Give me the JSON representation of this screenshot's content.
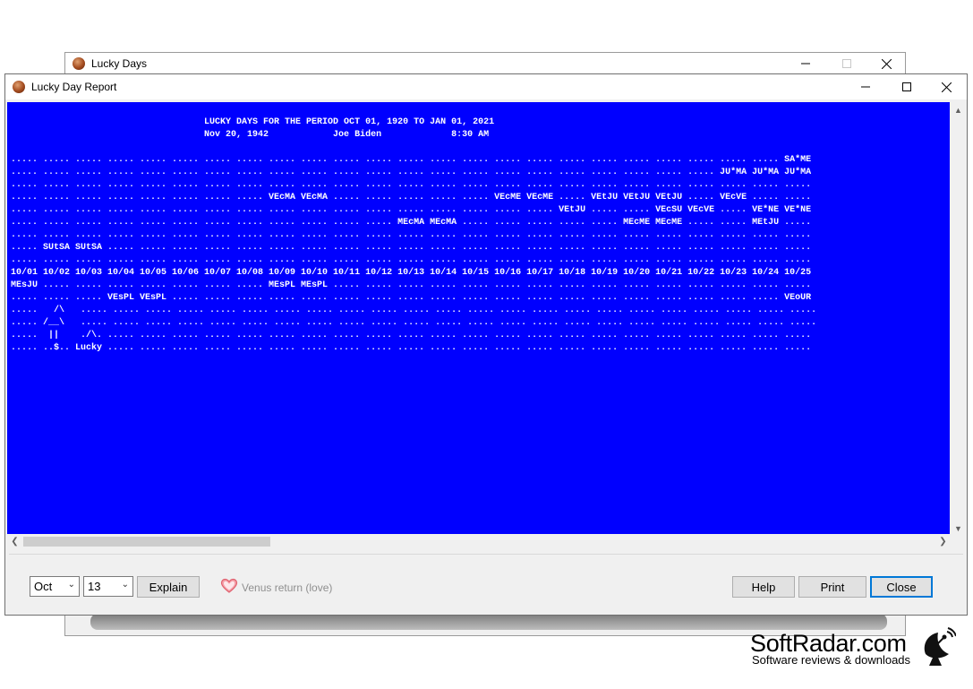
{
  "background_window": {
    "title": "Lucky Days",
    "icon": "lucky-days-app-icon",
    "controls": [
      "minimize",
      "maximize-disabled",
      "close"
    ]
  },
  "report_window": {
    "title": "Lucky Day Report",
    "icon": "lucky-days-app-icon",
    "controls": [
      "minimize",
      "maximize",
      "close"
    ],
    "background_color": "#0000ff",
    "text_color": "#ffffff",
    "report_lines": [
      "                                    LUCKY DAYS FOR THE PERIOD OCT 01, 1920 TO JAN 01, 2021",
      "                                    Nov 20, 1942            Joe Biden             8:30 AM",
      "",
      "..... ..... ..... ..... ..... ..... ..... ..... ..... ..... ..... ..... ..... ..... ..... ..... ..... ..... ..... ..... ..... ..... ..... ..... SA*ME",
      "..... ..... ..... ..... ..... ..... ..... ..... ..... ..... ..... ..... ..... ..... ..... ..... ..... ..... ..... ..... ..... ..... JU*MA JU*MA JU*MA",
      "..... ..... ..... ..... ..... ..... ..... ..... ..... ..... ..... ..... ..... ..... ..... ..... ..... ..... ..... ..... ..... ..... ..... ..... .....",
      "..... ..... ..... ..... ..... ..... ..... ..... VEcMA VEcMA ..... ..... ..... ..... ..... VEcME VEcME ..... VEtJU VEtJU VEtJU ..... VEcVE ..... .....",
      "..... ..... ..... ..... ..... ..... ..... ..... ..... ..... ..... ..... ..... ..... ..... ..... ..... VEtJU ..... ..... VEcSU VEcVE ..... VE*NE VE*NE",
      "..... ..... ..... ..... ..... ..... ..... ..... ..... ..... ..... ..... MEcMA MEcMA ..... ..... ..... ..... ..... MEcME MEcME ..... ..... MEtJU .....",
      "..... ..... ..... ..... ..... ..... ..... ..... ..... ..... ..... ..... ..... ..... ..... ..... ..... ..... ..... ..... ..... ..... ..... ..... .....",
      "..... SUtSA SUtSA ..... ..... ..... ..... ..... ..... ..... ..... ..... ..... ..... ..... ..... ..... ..... ..... ..... ..... ..... ..... ..... .....",
      "..... ..... ..... ..... ..... ..... ..... ..... ..... ..... ..... ..... ..... ..... ..... ..... ..... ..... ..... ..... ..... ..... ..... ..... .....",
      "10/01 10/02 10/03 10/04 10/05 10/06 10/07 10/08 10/09 10/10 10/11 10/12 10/13 10/14 10/15 10/16 10/17 10/18 10/19 10/20 10/21 10/22 10/23 10/24 10/25",
      "MEsJU ..... ..... ..... ..... ..... ..... ..... MEsPL MEsPL ..... ..... ..... ..... ..... ..... ..... ..... ..... ..... ..... ..... ..... ..... .....",
      "..... ..... ..... VEsPL VEsPL ..... ..... ..... ..... ..... ..... ..... ..... ..... ..... ..... ..... ..... ..... ..... ..... ..... ..... ..... VEoUR",
      ".....   /\\   ..... ..... ..... ..... ..... ..... ..... ..... ..... ..... ..... ..... ..... ..... ..... ..... ..... ..... ..... ..... ..... ..... .....",
      "..... /__\\   ..... ..... ..... ..... ..... ..... ..... ..... ..... ..... ..... ..... ..... ..... ..... ..... ..... ..... ..... ..... ..... ..... .....",
      ".....  ||    ./\\. ..... ..... ..... ..... ..... ..... ..... ..... ..... ..... ..... ..... ..... ..... ..... ..... ..... ..... ..... ..... ..... .....",
      "..... ..$.. Lucky ..... ..... ..... ..... ..... ..... ..... ..... ..... ..... ..... ..... ..... ..... ..... ..... ..... ..... ..... ..... ..... ....."
    ]
  },
  "controls": {
    "month_select": {
      "value": "Oct"
    },
    "day_select": {
      "value": "13"
    },
    "explain_button": "Explain",
    "venus_icon": "heart-icon",
    "venus_label": "Venus return (love)",
    "help_button": "Help",
    "print_button": "Print",
    "close_button": "Close"
  },
  "watermark": {
    "title": "SoftRadar.com",
    "subtitle": "Software reviews & downloads",
    "icon": "satellite-dish-icon"
  }
}
